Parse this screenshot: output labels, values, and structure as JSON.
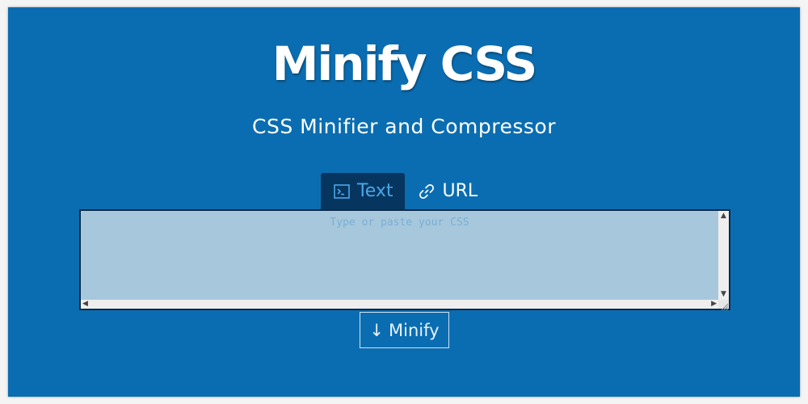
{
  "header": {
    "logo_text": "Minify CSS",
    "subtitle": "CSS Minifier and Compressor"
  },
  "tabs": [
    {
      "label": "Text",
      "icon": "terminal-icon",
      "active": true
    },
    {
      "label": "URL",
      "icon": "link-icon",
      "active": false
    }
  ],
  "editor": {
    "placeholder": "Type or paste your CSS",
    "value": ""
  },
  "actions": {
    "minify_arrow": "↓",
    "minify_label": "Minify"
  },
  "colors": {
    "background": "#0b6db1",
    "active_tab": "#063660",
    "active_tab_text": "#4aa6e8",
    "editor_background": "#a7c8dc"
  }
}
